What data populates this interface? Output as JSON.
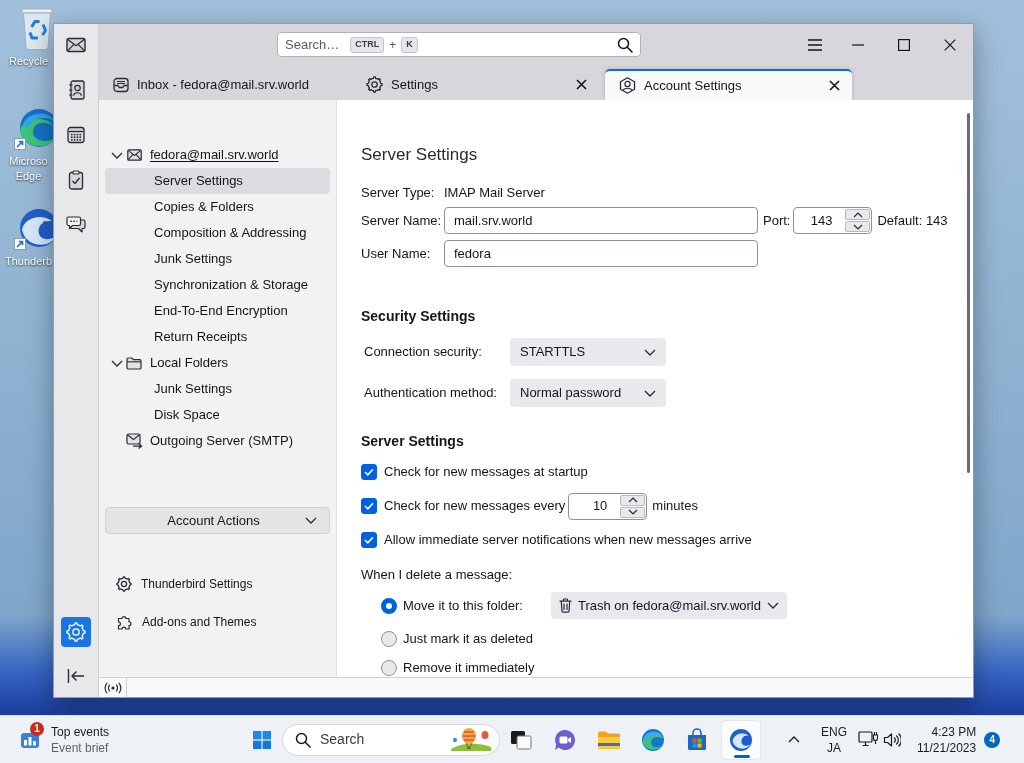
{
  "desktop": {
    "icons": [
      {
        "kind": "recycle",
        "label_lines": [
          "Recycle"
        ],
        "shortcut": false
      },
      {
        "kind": "browser",
        "label_lines": [
          "Microso",
          "Edge"
        ],
        "shortcut": true
      },
      {
        "kind": "mail",
        "label_lines": [
          "Thunderb"
        ],
        "shortcut": true
      }
    ]
  },
  "window": {
    "spaces_top": [
      {
        "kind": "mail",
        "selected": false
      },
      {
        "kind": "contacts",
        "selected": false
      },
      {
        "kind": "calendar",
        "selected": false
      },
      {
        "kind": "tasks",
        "selected": false
      },
      {
        "kind": "chat",
        "selected": false
      }
    ],
    "spaces_bottom": [
      {
        "kind": "settings",
        "selected": true
      }
    ],
    "search": {
      "placeholder": "Search…",
      "keys": [
        "CTRL",
        "K"
      ],
      "key_joiner": "+"
    },
    "tabs": [
      {
        "kind": "inbox",
        "label": "Inbox - fedora@mail.srv.world",
        "selected": false,
        "closable": false
      },
      {
        "kind": "settings",
        "label": "Settings",
        "selected": false,
        "closable": true
      },
      {
        "kind": "account",
        "label": "Account Settings",
        "selected": true,
        "closable": true
      }
    ],
    "account_tree": [
      {
        "kind": "account",
        "label": "fedora@mail.srv.world",
        "expanded": true,
        "selected": false,
        "children": [
          {
            "label": "Server Settings",
            "selected": true
          },
          {
            "label": "Copies & Folders",
            "selected": false
          },
          {
            "label": "Composition & Addressing",
            "selected": false
          },
          {
            "label": "Junk Settings",
            "selected": false
          },
          {
            "label": "Synchronization & Storage",
            "selected": false
          },
          {
            "label": "End-To-End Encryption",
            "selected": false
          },
          {
            "label": "Return Receipts",
            "selected": false
          }
        ]
      },
      {
        "kind": "folders",
        "label": "Local Folders",
        "expanded": true,
        "selected": false,
        "children": [
          {
            "label": "Junk Settings",
            "selected": false
          },
          {
            "label": "Disk Space",
            "selected": false
          }
        ]
      },
      {
        "kind": "smtp",
        "label": "Outgoing Server (SMTP)",
        "selected": false
      }
    ],
    "account_actions": {
      "label": "Account Actions"
    },
    "nav_links": [
      {
        "kind": "settings",
        "label": "Thunderbird Settings"
      },
      {
        "kind": "addons",
        "label": "Add-ons and Themes"
      }
    ],
    "content": {
      "title": "Server Settings",
      "server_type": {
        "label": "Server Type:",
        "value": "IMAP Mail Server"
      },
      "server_name": {
        "label": "Server Name:",
        "value": "mail.srv.world"
      },
      "port": {
        "label": "Port:",
        "value": "143",
        "default": "Default: 143"
      },
      "user_name": {
        "label": "User Name:",
        "value": "fedora"
      },
      "security": {
        "heading": "Security Settings",
        "fields": [
          {
            "label": "Connection security:",
            "value": "STARTTLS"
          },
          {
            "label": "Authentication method:",
            "value": "Normal password"
          }
        ]
      },
      "server_settings": {
        "heading": "Server Settings",
        "checks": [
          {
            "label": "Check for new messages at startup",
            "checked": true
          },
          {
            "label": "Check for new messages every",
            "checked": true,
            "interval": "10",
            "suffix": "minutes"
          },
          {
            "label": "Allow immediate server notifications when new messages arrive",
            "checked": true
          }
        ],
        "delete_prompt": "When I delete a message:",
        "delete_options": [
          {
            "label": "Move it to this folder:",
            "selected": true,
            "folder": "Trash on fedora@mail.srv.world"
          },
          {
            "label": "Just mark it as deleted",
            "selected": false
          },
          {
            "label": "Remove it immediately",
            "selected": false
          }
        ]
      }
    }
  },
  "taskbar": {
    "widget": {
      "badge": "1",
      "title": "Top events",
      "subtitle": "Event brief"
    },
    "search": {
      "placeholder": "Search"
    },
    "apps": [
      {
        "kind": "taskview",
        "selected": false
      },
      {
        "kind": "meet",
        "selected": false
      },
      {
        "kind": "explorer",
        "selected": false
      },
      {
        "kind": "browser",
        "selected": false
      },
      {
        "kind": "store",
        "selected": false
      },
      {
        "kind": "mail",
        "selected": true
      }
    ],
    "input_language": [
      "ENG",
      "JA"
    ],
    "time": "4:23 PM",
    "date": "11/21/2023",
    "notification_count": "4"
  }
}
